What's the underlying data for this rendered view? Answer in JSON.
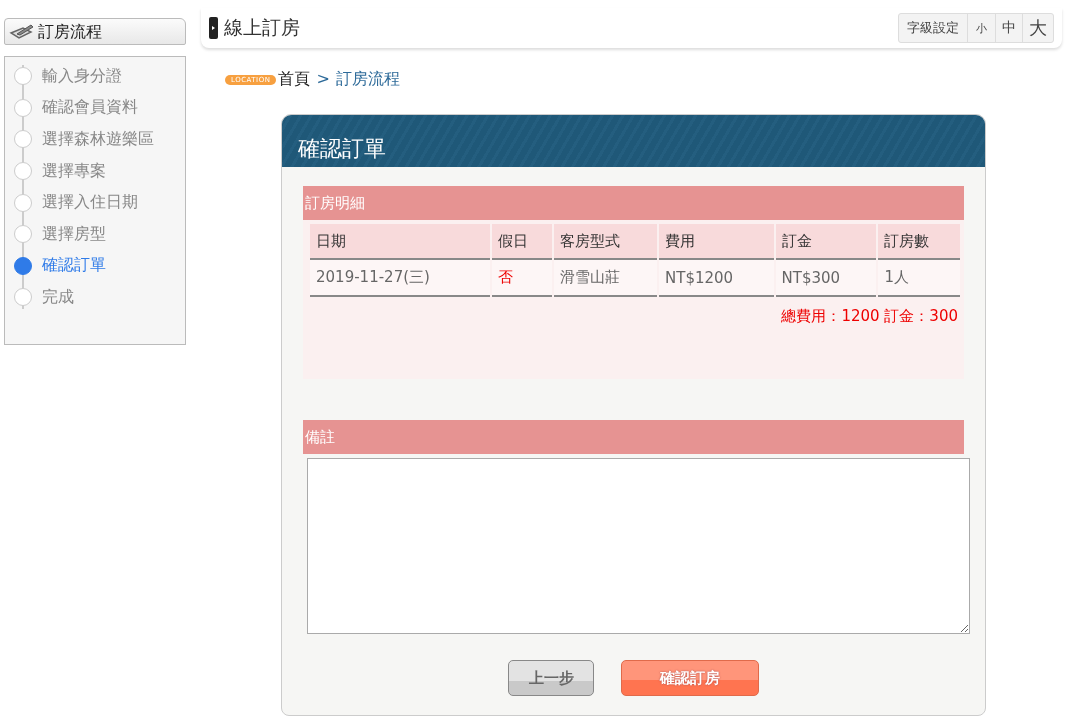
{
  "sidebar": {
    "title": "訂房流程",
    "steps": [
      {
        "label": "輸入身分證",
        "selected": false
      },
      {
        "label": "確認會員資料",
        "selected": false
      },
      {
        "label": "選擇森林遊樂區",
        "selected": false
      },
      {
        "label": "選擇專案",
        "selected": false
      },
      {
        "label": "選擇入住日期",
        "selected": false
      },
      {
        "label": "選擇房型",
        "selected": false
      },
      {
        "label": "確認訂單",
        "selected": true
      },
      {
        "label": "完成",
        "selected": false
      }
    ]
  },
  "header": {
    "title": "線上訂房",
    "font_size": [
      {
        "label": "字級設定",
        "kind": "label"
      },
      {
        "label": "小",
        "kind": "small"
      },
      {
        "label": "中",
        "kind": "medium"
      },
      {
        "label": "大",
        "kind": "large"
      }
    ]
  },
  "breadcrumb": {
    "badge": "LOCATION",
    "items": [
      "首頁",
      "訂房流程"
    ],
    "separator": ">"
  },
  "card": {
    "title": "確認訂單",
    "details": {
      "title": "訂房明細",
      "columns": [
        {
          "label": "日期",
          "highlight": false
        },
        {
          "label": "假日",
          "highlight": true
        },
        {
          "label": "客房型式",
          "highlight": false
        },
        {
          "label": "費用",
          "highlight": false
        },
        {
          "label": "訂金",
          "highlight": false
        },
        {
          "label": "訂房數",
          "highlight": false
        }
      ],
      "rows": [
        [
          "2019-11-27(三)",
          "否",
          "滑雪山莊",
          "NT$1200",
          "NT$300",
          "1人"
        ]
      ],
      "total": "總費用：1200 訂金：300"
    },
    "remarks": {
      "title": "備註"
    },
    "buttons": [
      {
        "label": "上一步",
        "kind": "back"
      },
      {
        "label": "確認訂房",
        "kind": "confirm"
      }
    ]
  }
}
